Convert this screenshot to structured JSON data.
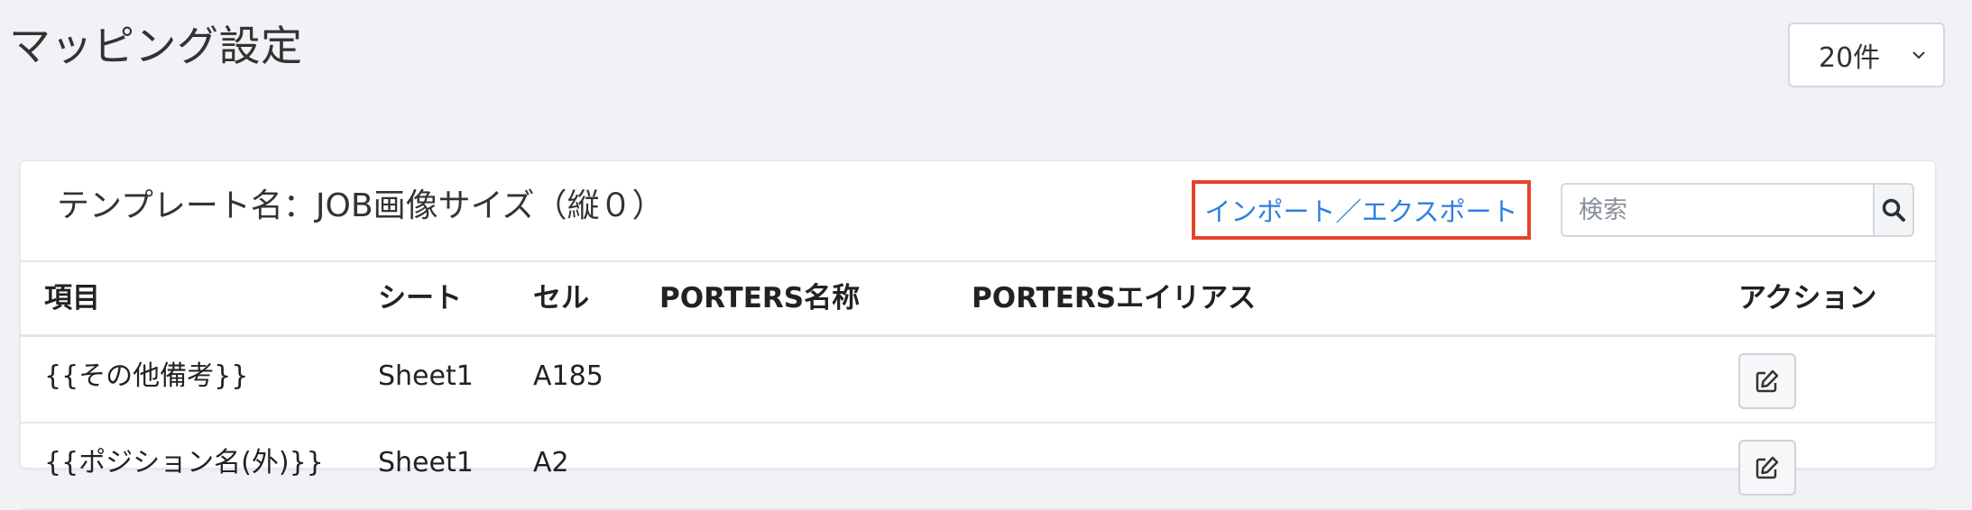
{
  "page": {
    "title": "マッピング設定"
  },
  "page_size": {
    "selected": "20件"
  },
  "card": {
    "template_name": "テンプレート名：JOB画像サイズ（縦０）",
    "import_export_label": "インポート／エクスポート",
    "search_placeholder": "検索"
  },
  "table": {
    "headers": [
      "項目",
      "シート",
      "セル",
      "PORTERS名称",
      "PORTERSエイリアス",
      "アクション"
    ],
    "rows": [
      {
        "item": "{{その他備考}}",
        "sheet": "Sheet1",
        "cell": "A185",
        "porters_name": "",
        "porters_alias": ""
      },
      {
        "item": "{{ポジション名(外)}}",
        "sheet": "Sheet1",
        "cell": "A2",
        "porters_name": "",
        "porters_alias": ""
      }
    ]
  },
  "icons": {
    "search": "search-icon",
    "edit": "edit-icon",
    "chevron": "chevron-down-icon"
  },
  "colors": {
    "link": "#2f7fe0",
    "highlight_border": "#e3442b",
    "background": "#f1f2f6"
  }
}
